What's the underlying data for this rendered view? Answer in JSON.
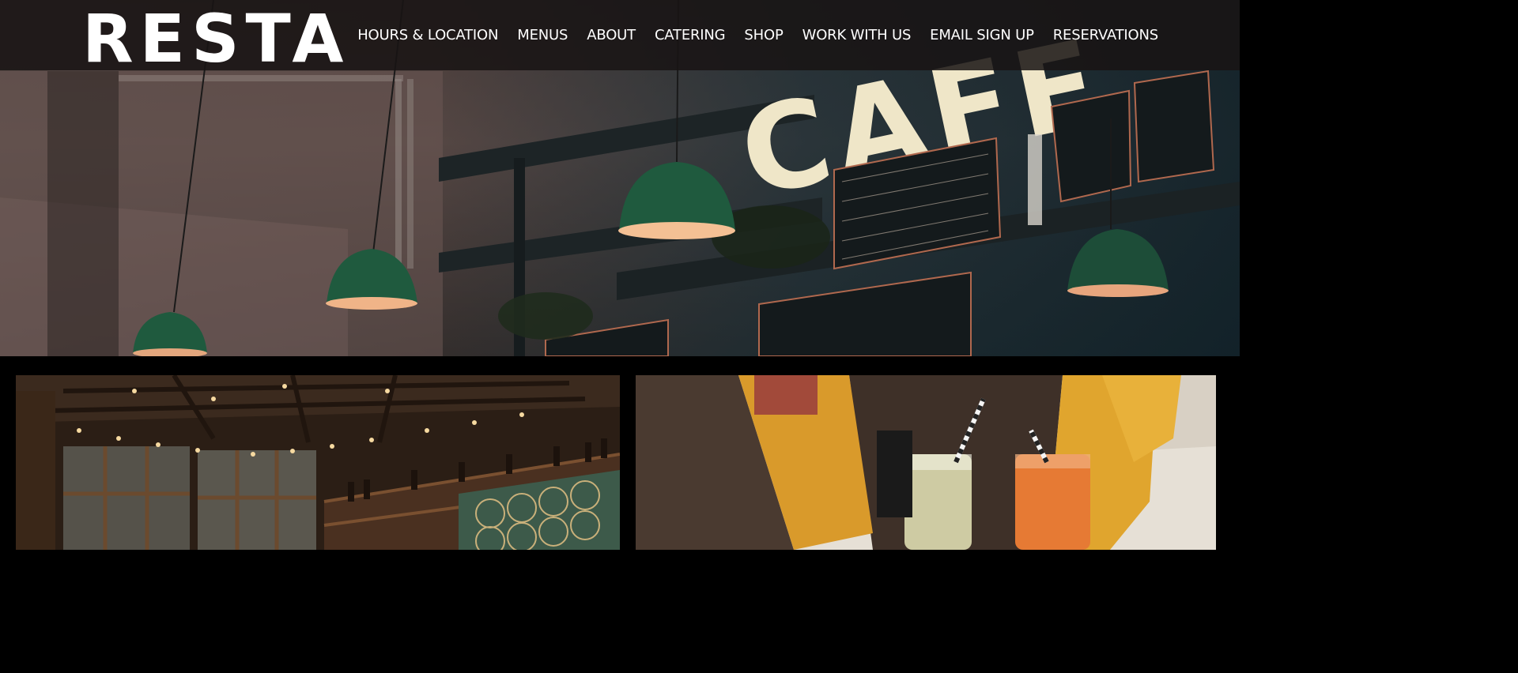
{
  "site": {
    "logo": "RESTA"
  },
  "nav": {
    "items": [
      {
        "id": "hours",
        "label": "HOURS & LOCATION"
      },
      {
        "id": "menus",
        "label": "MENUS"
      },
      {
        "id": "about",
        "label": "ABOUT"
      },
      {
        "id": "catering",
        "label": "CATERING"
      },
      {
        "id": "shop",
        "label": "SHOP"
      },
      {
        "id": "work",
        "label": "WORK WITH US"
      },
      {
        "id": "email",
        "label": "EMAIL SIGN UP"
      },
      {
        "id": "reservations",
        "label": "RESERVATIONS"
      }
    ]
  },
  "hero": {
    "sign_text": "CAFE"
  },
  "colors": {
    "header_bg": "#181414",
    "text": "#ffffff",
    "lamp_green": "#1f5a3e",
    "page_bg": "#000000"
  }
}
